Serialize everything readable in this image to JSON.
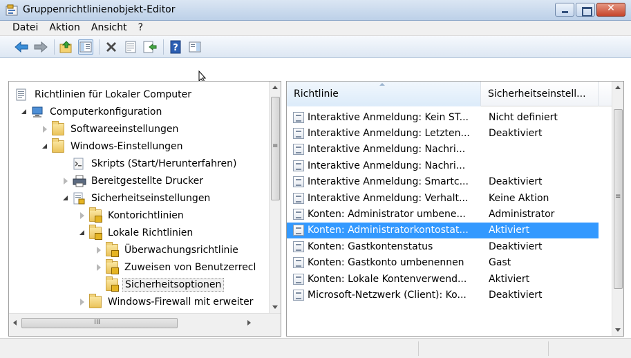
{
  "window": {
    "title": "Gruppenrichtlinienobjekt-Editor",
    "close_glyph": "✕"
  },
  "menu": [
    "Datei",
    "Aktion",
    "Ansicht",
    "?"
  ],
  "toolbar": {
    "buttons": [
      "back-arrow-icon",
      "forward-arrow-icon",
      "up-folder-icon",
      "show-hide-tree-icon",
      "delete-icon",
      "properties-icon",
      "export-list-icon",
      "help-icon",
      "show-hide-action-pane-icon"
    ]
  },
  "tree": {
    "nodes": [
      {
        "label": "Richtlinien für Lokaler Computer",
        "level": 0,
        "expander": "none",
        "icon": "policy-document-icon"
      },
      {
        "label": "Computerkonfiguration",
        "level": 0,
        "expander": "open",
        "icon": "computer-icon"
      },
      {
        "label": "Softwareeinstellungen",
        "level": 1,
        "expander": "closed",
        "icon": "folder-icon"
      },
      {
        "label": "Windows-Einstellungen",
        "level": 1,
        "expander": "open",
        "icon": "folder-icon"
      },
      {
        "label": "Skripts (Start/Herunterfahren)",
        "level": 2,
        "expander": "none",
        "icon": "script-icon"
      },
      {
        "label": "Bereitgestellte Drucker",
        "level": 2,
        "expander": "closed",
        "icon": "printer-icon"
      },
      {
        "label": "Sicherheitseinstellungen",
        "level": 2,
        "expander": "open",
        "icon": "security-settings-icon"
      },
      {
        "label": "Kontorichtlinien",
        "level": 3,
        "expander": "closed",
        "icon": "lock-folder-icon"
      },
      {
        "label": "Lokale Richtlinien",
        "level": 3,
        "expander": "open",
        "icon": "lock-folder-icon"
      },
      {
        "label": "Überwachungsrichtlinie",
        "level": 4,
        "expander": "closed",
        "icon": "lock-folder-icon"
      },
      {
        "label": "Zuweisen von Benutzerrecl",
        "level": 4,
        "expander": "closed",
        "icon": "lock-folder-icon"
      },
      {
        "label": "Sicherheitsoptionen",
        "level": 4,
        "expander": "none",
        "icon": "lock-folder-icon",
        "selected": true
      },
      {
        "label": "Windows-Firewall mit erweiter",
        "level": 3,
        "expander": "closed",
        "icon": "folder-icon"
      }
    ]
  },
  "list": {
    "columns": [
      "Richtlinie",
      "Sicherheitseinstell..."
    ],
    "rows": [
      {
        "policy": "Interaktive Anmeldung: Kein ST...",
        "setting": "Nicht definiert"
      },
      {
        "policy": "Interaktive Anmeldung: Letzten...",
        "setting": "Deaktiviert"
      },
      {
        "policy": "Interaktive Anmeldung: Nachri...",
        "setting": ""
      },
      {
        "policy": "Interaktive Anmeldung: Nachri...",
        "setting": ""
      },
      {
        "policy": "Interaktive Anmeldung: Smartc...",
        "setting": "Deaktiviert"
      },
      {
        "policy": "Interaktive Anmeldung: Verhalt...",
        "setting": "Keine Aktion"
      },
      {
        "policy": "Konten: Administrator umbene...",
        "setting": "Administrator"
      },
      {
        "policy": "Konten: Administratorkontostat...",
        "setting": "Aktiviert",
        "selected": true
      },
      {
        "policy": "Konten: Gastkontenstatus",
        "setting": "Deaktiviert"
      },
      {
        "policy": "Konten: Gastkonto umbenennen",
        "setting": "Gast"
      },
      {
        "policy": "Konten: Lokale Kontenverwend...",
        "setting": "Aktiviert"
      },
      {
        "policy": "Microsoft-Netzwerk (Client): Ko...",
        "setting": "Deaktiviert"
      }
    ]
  },
  "scroll": {
    "hscroll_thumb_glyph": "III",
    "vscroll_grip_glyph": "≡"
  }
}
